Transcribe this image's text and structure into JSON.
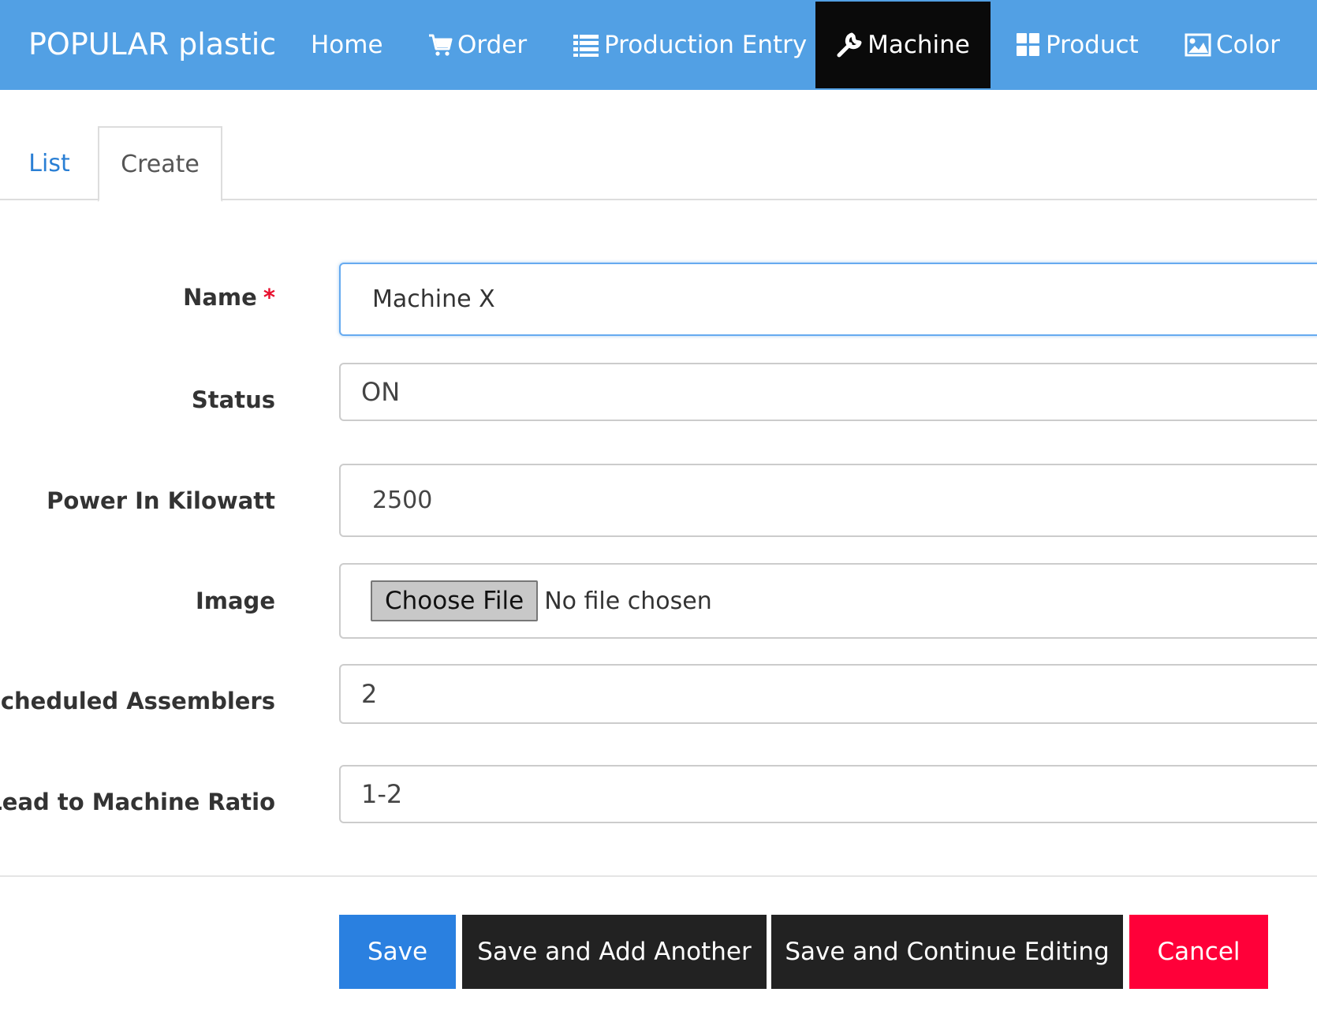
{
  "navbar": {
    "brand": "POPULAR plastic",
    "items": [
      {
        "label": "Home",
        "icon": "none"
      },
      {
        "label": "Order",
        "icon": "cart-icon"
      },
      {
        "label": "Production Entry",
        "icon": "list-icon"
      },
      {
        "label": "Machine",
        "icon": "wrench-icon",
        "active": true
      },
      {
        "label": "Product",
        "icon": "grid-icon"
      },
      {
        "label": "Color",
        "icon": "image-icon"
      }
    ],
    "colors": {
      "background": "#52a0e4",
      "active": "#0a0a0a"
    }
  },
  "tabs": [
    {
      "label": "List",
      "active": false
    },
    {
      "label": "Create",
      "active": true
    }
  ],
  "form": {
    "name": {
      "label": "Name",
      "required_mark": "*",
      "value": "Machine X"
    },
    "status": {
      "label": "Status",
      "value": "ON"
    },
    "power": {
      "label": "Power In Kilowatt",
      "value": "2500"
    },
    "image": {
      "label": "Image",
      "button": "Choose File",
      "file_status": "No file chosen"
    },
    "assemblers": {
      "label": "Scheduled Assemblers",
      "value": "2"
    },
    "ratio": {
      "label": "Lead to Machine Ratio",
      "value": "1-2"
    }
  },
  "actions": {
    "save": "Save",
    "save_add": "Save and Add Another",
    "save_continue": "Save and Continue Editing",
    "cancel": "Cancel",
    "colors": {
      "save": "#2a80e0",
      "secondary": "#222222",
      "cancel": "#ff0039"
    }
  }
}
